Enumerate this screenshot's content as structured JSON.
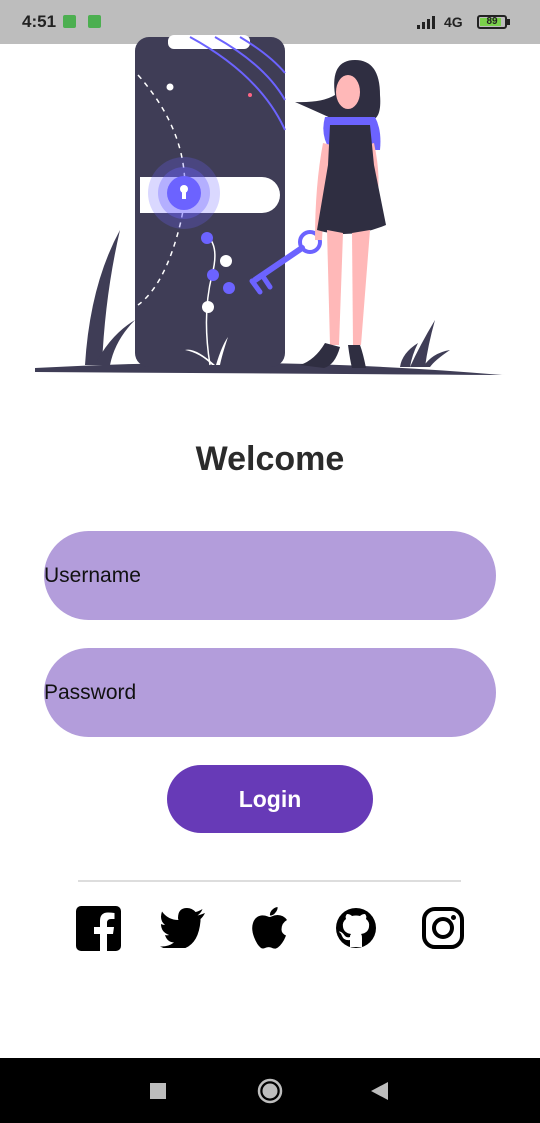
{
  "status_bar": {
    "time": "4:51",
    "network": "4G",
    "battery_level": "89",
    "battery_fraction": 0.89,
    "icons": [
      "notification-icon",
      "notification-icon",
      "signal-icon",
      "battery-icon"
    ]
  },
  "hero": {
    "icon": "login-illustration"
  },
  "welcome_title": "Welcome",
  "form": {
    "username_placeholder": "Username",
    "password_placeholder": "Password",
    "login_label": "Login"
  },
  "social_icons": [
    "facebook-icon",
    "twitter-icon",
    "apple-icon",
    "github-icon",
    "instagram-icon"
  ],
  "nav_icons": [
    "recents-icon",
    "home-icon",
    "back-icon"
  ],
  "colors": {
    "accent": "#673ab7",
    "field_background": "#b39ddb",
    "illustration_dark": "#3f3d56",
    "illustration_accent": "#6c63ff",
    "skin": "#ffb8b8"
  }
}
